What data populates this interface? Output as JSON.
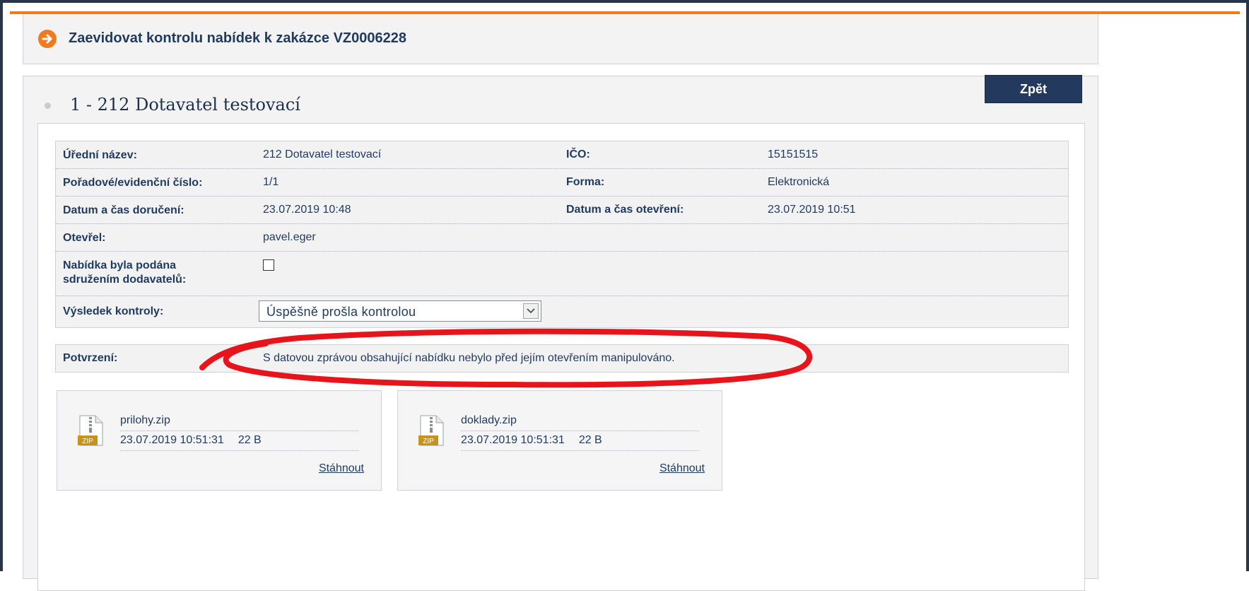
{
  "header": {
    "title": "Zaevidovat kontrolu nabídek k zakázce VZ0006228"
  },
  "section": {
    "title": "1 - 212 Dotavatel testovací",
    "back_label": "Zpět"
  },
  "details": {
    "official_name_label": "Úřední název:",
    "official_name_value": "212 Dotavatel testovací",
    "ico_label": "IČO:",
    "ico_value": "15151515",
    "order_number_label": "Pořadové/evidenční číslo:",
    "order_number_value": "1/1",
    "form_label": "Forma:",
    "form_value": "Elektronická",
    "delivery_label": "Datum a čas doručení:",
    "delivery_value": "23.07.2019 10:48",
    "opening_label": "Datum a čas otevření:",
    "opening_value": "23.07.2019 10:51",
    "opened_by_label": "Otevřel:",
    "opened_by_value": "pavel.eger",
    "consortium_label_line1": "Nabídka byla podána",
    "consortium_label_line2": "sdružením dodavatelů:",
    "consortium_checked": false,
    "result_label": "Výsledek kontroly:",
    "result_value": "Úspěšně prošla kontrolou"
  },
  "confirmation": {
    "label": "Potvrzení:",
    "text": "S datovou zprávou obsahující nabídku nebylo před jejím otevřením manipulováno."
  },
  "files": [
    {
      "name": "prilohy.zip",
      "date": "23.07.2019 10:51:31",
      "size": "22 B",
      "icon_text": "ZIP",
      "download_label": "Stáhnout"
    },
    {
      "name": "doklady.zip",
      "date": "23.07.2019 10:51:31",
      "size": "22 B",
      "icon_text": "ZIP",
      "download_label": "Stáhnout"
    }
  ],
  "colors": {
    "accent_orange": "#f07a1e",
    "navy": "#23395d",
    "annotation_red": "#e8141c"
  }
}
